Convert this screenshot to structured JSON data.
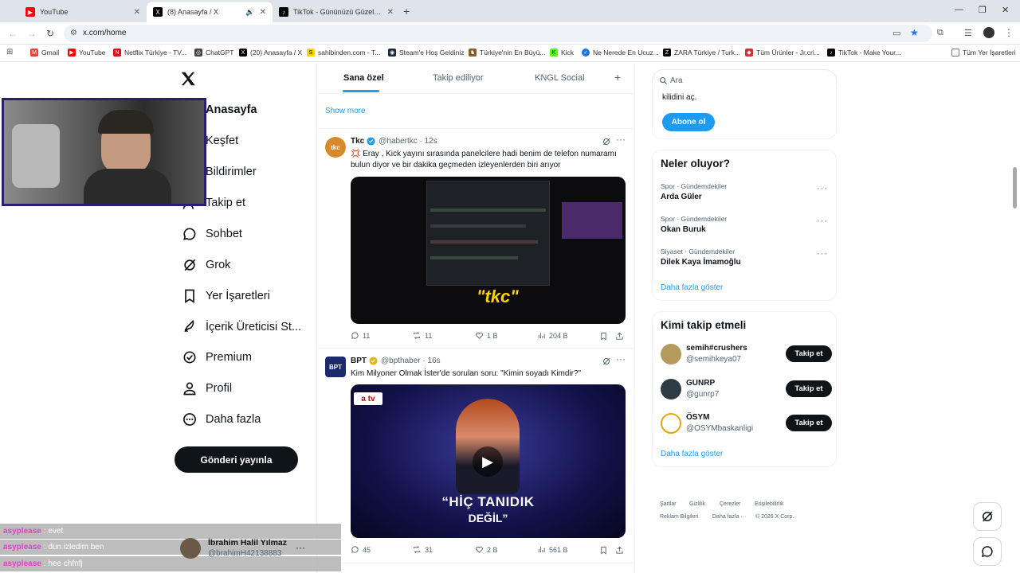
{
  "browser": {
    "tabs": [
      {
        "label": "YouTube",
        "color": "#ff0000",
        "glyph": "▶"
      },
      {
        "label": "(8) Anasayfa / X",
        "color": "#000000",
        "glyph": "X"
      },
      {
        "label": "TikTok - Gününüzü Güzelleştirin",
        "color": "#000000",
        "glyph": "♪"
      }
    ],
    "url": "x.com/home",
    "bookmarks": [
      {
        "label": "Gmail",
        "color": "#ea4335",
        "glyph": "M"
      },
      {
        "label": "YouTube",
        "color": "#ff0000",
        "glyph": "▶"
      },
      {
        "label": "Netflix Türkiye - TV...",
        "color": "#e50914",
        "glyph": "N"
      },
      {
        "label": "ChatGPT",
        "color": "#444444",
        "glyph": "◎"
      },
      {
        "label": "(20) Anasayfa / X",
        "color": "#000000",
        "glyph": "X"
      },
      {
        "label": "sahibinden.com - T...",
        "color": "#ffd400",
        "glyph": "S"
      },
      {
        "label": "Steam'e Hoş Geldiniz",
        "color": "#1b2838",
        "glyph": "◉"
      },
      {
        "label": "Türkiye'nin En Büyü...",
        "color": "#8a5a2b",
        "glyph": "♞"
      },
      {
        "label": "Kick",
        "color": "#53fc18",
        "glyph": "K"
      },
      {
        "label": "Ne Nerede En Ucuz...",
        "color": "#1a73e8",
        "glyph": "✓"
      },
      {
        "label": "ZARA Türkiye / Turk...",
        "color": "#000000",
        "glyph": "Z"
      },
      {
        "label": "Tüm Ürünler - Jr.cri...",
        "color": "#d32f2f",
        "glyph": "◆"
      },
      {
        "label": "TikTok - Make Your...",
        "color": "#000000",
        "glyph": "♪"
      }
    ],
    "all_bookmarks": "Tüm Yer İşaretleri"
  },
  "sidebar": {
    "items": [
      {
        "label": "Anasayfa"
      },
      {
        "label": "Keşfet"
      },
      {
        "label": "Bildirimler"
      },
      {
        "label": "Takip et"
      },
      {
        "label": "Sohbet"
      },
      {
        "label": "Grok"
      },
      {
        "label": "Yer İşaretleri"
      },
      {
        "label": "İçerik Üreticisi St..."
      },
      {
        "label": "Premium"
      },
      {
        "label": "Profil"
      },
      {
        "label": "Daha fazla"
      }
    ],
    "post_button": "Gönderi yayınla"
  },
  "feed": {
    "tabs": [
      "Sana özel",
      "Takip ediliyor",
      "KNGL Social"
    ],
    "show_more": "Show more",
    "tweets": [
      {
        "name": "Tkc",
        "handle": "@habertkc · 12s",
        "avatar_text": "tkc",
        "avatar_color": "#d88a2a",
        "badge_color": "#1d9bf0",
        "text": "💢 Eray , Kick yayını sırasında panelcilere hadi benim de telefon numaramı bulun diyor ve bir dakika geçmeden izleyenlerden biri arıyor",
        "media_label": "\"tkc\"",
        "replies": "11",
        "reposts": "11",
        "likes": "1 B",
        "views": "204 B"
      },
      {
        "name": "BPT",
        "handle": "@bpthaber · 16s",
        "avatar_text": "BPT",
        "avatar_color": "#1b2a6b",
        "badge_color": "#e2b719",
        "text": "Kim Milyoner Olmak İster'de sorulan soru: \"Kimin soyadı Kimdir?\"",
        "media_channel": "a tv",
        "media_caption_1": "“HİÇ TANIDIK",
        "media_caption_2": "DEĞİL”",
        "replies": "45",
        "reposts": "31",
        "likes": "2 B",
        "views": "561 B"
      }
    ]
  },
  "right": {
    "search_placeholder": "Ara",
    "subscribe_text": "kilidini aç.",
    "subscribe_button": "Abone ol",
    "trends_title": "Neler oluyor?",
    "trends": [
      {
        "meta": "Spor · Gündemdekiler",
        "title": "Arda Güler"
      },
      {
        "meta": "Spor · Gündemdekiler",
        "title": "Okan Buruk"
      },
      {
        "meta": "Siyaset · Gündemdekiler",
        "title": "Dilek Kaya İmamoğlu"
      }
    ],
    "show_more": "Daha fazla göster",
    "who_title": "Kimi takip etmeli",
    "who": [
      {
        "name": "semih#crushers",
        "handle": "@semihkeya07",
        "color": "#b49a5c"
      },
      {
        "name": "GUNRP",
        "handle": "@gunrp7",
        "color": "#2e3a44"
      },
      {
        "name": "ÖSYM",
        "handle": "@OSYMbaskanligi",
        "color": "#e8a21a"
      }
    ],
    "follow": "Takip et",
    "footer_1": [
      "Şartlar",
      "Gizlilik",
      "Çerezler",
      "Erişilebilirlik"
    ],
    "footer_2": [
      "Reklam Bilgileri",
      "Daha fazla ···",
      "© 2026 X Corp."
    ]
  },
  "stream": {
    "chat": [
      {
        "user": "asyplease",
        "msg": ": evet"
      },
      {
        "user": "asyplease",
        "msg": ": dun izledim ben"
      },
      {
        "user": "asyplease",
        "msg": ": hee chfnfj"
      }
    ],
    "popup_name": "İbrahim Halil Yılmaz",
    "popup_handle": "@brahimH42138883"
  }
}
